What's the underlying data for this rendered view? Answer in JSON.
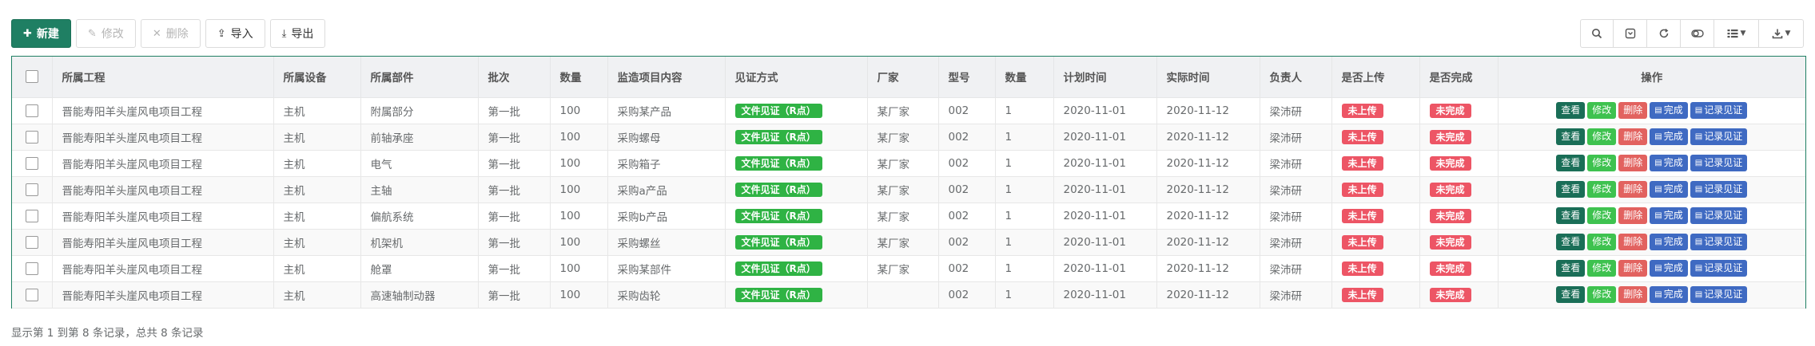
{
  "toolbar": {
    "new_label": "新建",
    "edit_label": "修改",
    "delete_label": "删除",
    "import_label": "导入",
    "export_label": "导出"
  },
  "table": {
    "headers": [
      "所属工程",
      "所属设备",
      "所属部件",
      "批次",
      "数量",
      "监造项目内容",
      "见证方式",
      "厂家",
      "型号",
      "数量",
      "计划时间",
      "实际时间",
      "负责人",
      "是否上传",
      "是否完成",
      "操作"
    ],
    "rows": [
      {
        "project": "晋能寿阳羊头崖风电项目工程",
        "equipment": "主机",
        "component": "附属部分",
        "batch": "第一批",
        "qty": "100",
        "content": "采购某产品",
        "witness": "文件见证（R点）",
        "maker": "某厂家",
        "model": "002",
        "count": "1",
        "plan": "2020-11-01",
        "actual": "2020-11-12",
        "owner": "梁沛研",
        "uploaded": "未上传",
        "completed": "未完成"
      },
      {
        "project": "晋能寿阳羊头崖风电项目工程",
        "equipment": "主机",
        "component": "前轴承座",
        "batch": "第一批",
        "qty": "100",
        "content": "采购螺母",
        "witness": "文件见证（R点）",
        "maker": "某厂家",
        "model": "002",
        "count": "1",
        "plan": "2020-11-01",
        "actual": "2020-11-12",
        "owner": "梁沛研",
        "uploaded": "未上传",
        "completed": "未完成"
      },
      {
        "project": "晋能寿阳羊头崖风电项目工程",
        "equipment": "主机",
        "component": "电气",
        "batch": "第一批",
        "qty": "100",
        "content": "采购箱子",
        "witness": "文件见证（R点）",
        "maker": "某厂家",
        "model": "002",
        "count": "1",
        "plan": "2020-11-01",
        "actual": "2020-11-12",
        "owner": "梁沛研",
        "uploaded": "未上传",
        "completed": "未完成"
      },
      {
        "project": "晋能寿阳羊头崖风电项目工程",
        "equipment": "主机",
        "component": "主轴",
        "batch": "第一批",
        "qty": "100",
        "content": "采购a产品",
        "witness": "文件见证（R点）",
        "maker": "某厂家",
        "model": "002",
        "count": "1",
        "plan": "2020-11-01",
        "actual": "2020-11-12",
        "owner": "梁沛研",
        "uploaded": "未上传",
        "completed": "未完成"
      },
      {
        "project": "晋能寿阳羊头崖风电项目工程",
        "equipment": "主机",
        "component": "偏航系统",
        "batch": "第一批",
        "qty": "100",
        "content": "采购b产品",
        "witness": "文件见证（R点）",
        "maker": "某厂家",
        "model": "002",
        "count": "1",
        "plan": "2020-11-01",
        "actual": "2020-11-12",
        "owner": "梁沛研",
        "uploaded": "未上传",
        "completed": "未完成"
      },
      {
        "project": "晋能寿阳羊头崖风电项目工程",
        "equipment": "主机",
        "component": "机架机",
        "batch": "第一批",
        "qty": "100",
        "content": "采购螺丝",
        "witness": "文件见证（R点）",
        "maker": "某厂家",
        "model": "002",
        "count": "1",
        "plan": "2020-11-01",
        "actual": "2020-11-12",
        "owner": "梁沛研",
        "uploaded": "未上传",
        "completed": "未完成"
      },
      {
        "project": "晋能寿阳羊头崖风电项目工程",
        "equipment": "主机",
        "component": "舱罩",
        "batch": "第一批",
        "qty": "100",
        "content": "采购某部件",
        "witness": "文件见证（R点）",
        "maker": "某厂家",
        "model": "002",
        "count": "1",
        "plan": "2020-11-01",
        "actual": "2020-11-12",
        "owner": "梁沛研",
        "uploaded": "未上传",
        "completed": "未完成"
      },
      {
        "project": "晋能寿阳羊头崖风电项目工程",
        "equipment": "主机",
        "component": "高速轴制动器",
        "batch": "第一批",
        "qty": "100",
        "content": "采购齿轮",
        "witness": "文件见证（R点）",
        "maker": "",
        "model": "002",
        "count": "1",
        "plan": "2020-11-01",
        "actual": "2020-11-12",
        "owner": "梁沛研",
        "uploaded": "未上传",
        "completed": "未完成"
      }
    ],
    "actions": {
      "view": "查看",
      "edit": "修改",
      "delete": "删除",
      "done": "完成",
      "record": "记录见证"
    }
  },
  "footer": {
    "summary": "显示第 1 到第 8 条记录，总共 8 条记录"
  },
  "colors": {
    "primary": "#1f7f63",
    "green_tag": "#2fb344",
    "red_tag": "#ed5565",
    "blue_btn": "#3f6ac2"
  },
  "icons": [
    "plus-icon",
    "edit-icon",
    "close-icon",
    "upload-icon",
    "download-icon",
    "search-icon",
    "collapse-icon",
    "refresh-icon",
    "toggle-icon",
    "columns-icon",
    "export-icon",
    "caret-down-icon"
  ]
}
